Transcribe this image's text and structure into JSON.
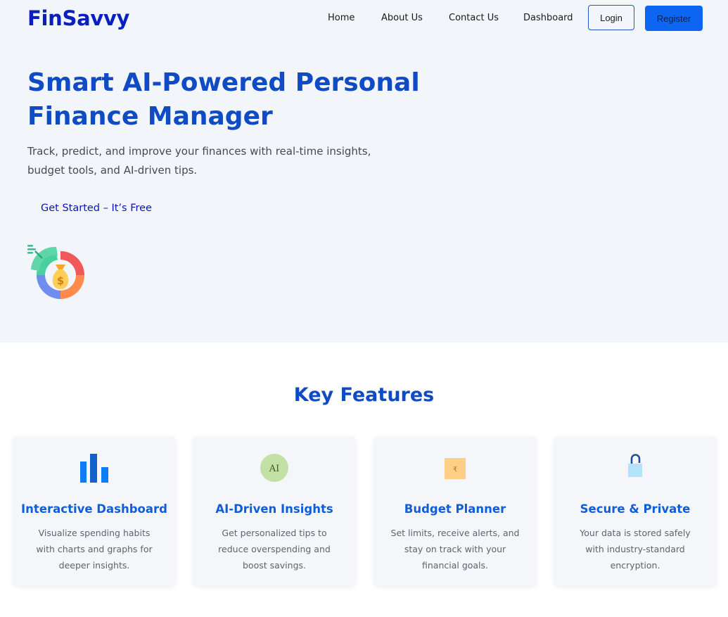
{
  "brand": "FinSavvy",
  "nav": {
    "links": [
      "Home",
      "About Us",
      "Contact Us",
      "Dashboard"
    ],
    "login": "Login",
    "register": "Register"
  },
  "hero": {
    "title": "Smart AI-Powered Personal Finance Manager",
    "subtitle": "Track, predict, and improve your finances with real-time insights, budget tools, and AI-driven tips.",
    "cta": "Get Started – It’s Free",
    "icon": "money-bag-donut-chart-icon"
  },
  "features": {
    "title": "Key Features",
    "cards": [
      {
        "icon": "bar-chart-icon",
        "title": "Interactive Dashboard",
        "desc": "Visualize spending habits with charts and graphs for deeper insights."
      },
      {
        "icon": "ai-badge-icon",
        "icon_text": "AI",
        "title": "AI-Driven Insights",
        "desc": "Get personalized tips to reduce overspending and boost savings."
      },
      {
        "icon": "rupee-note-icon",
        "icon_text": "₹",
        "title": "Budget Planner",
        "desc": "Set limits, receive alerts, and stay on track with your financial goals."
      },
      {
        "icon": "lock-icon",
        "title": "Secure & Private",
        "desc": "Your data is stored safely with industry-standard encryption."
      }
    ]
  },
  "colors": {
    "brand": "#0a1fc2",
    "heading": "#0f4bc4",
    "accent": "#0d66f2",
    "hero_bg": "#f2f5f9"
  }
}
